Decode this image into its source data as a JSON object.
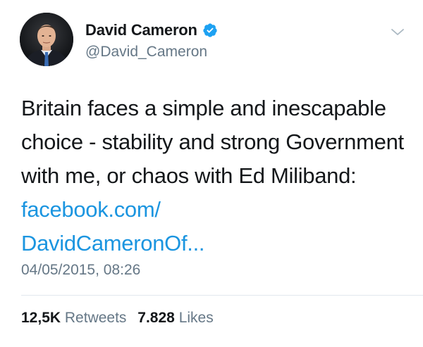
{
  "author": {
    "display_name": "David Cameron",
    "handle": "@David_Cameron",
    "verified": true,
    "verified_icon": "verified-badge-icon",
    "avatar_icon": "profile-photo"
  },
  "tweet": {
    "text_plain": "Britain faces a simple and inescapable choice - stability and strong Government with me, or chaos with Ed Miliband: ",
    "link_text": "facebook.com/\nDavidCameronOf...",
    "link_line1": "facebook.com/",
    "link_line2": "DavidCameronOf...",
    "timestamp": "04/05/2015, 08:26"
  },
  "stats": {
    "retweets_count": "12,5K",
    "retweets_label": "Retweets",
    "likes_count": "7.828",
    "likes_label": "Likes"
  },
  "colors": {
    "text": "#14171a",
    "secondary": "#657786",
    "link": "#1b95e0",
    "verified": "#1da1f2",
    "divider": "#e1e8ed"
  },
  "icons": {
    "caret": "chevron-down-icon"
  }
}
